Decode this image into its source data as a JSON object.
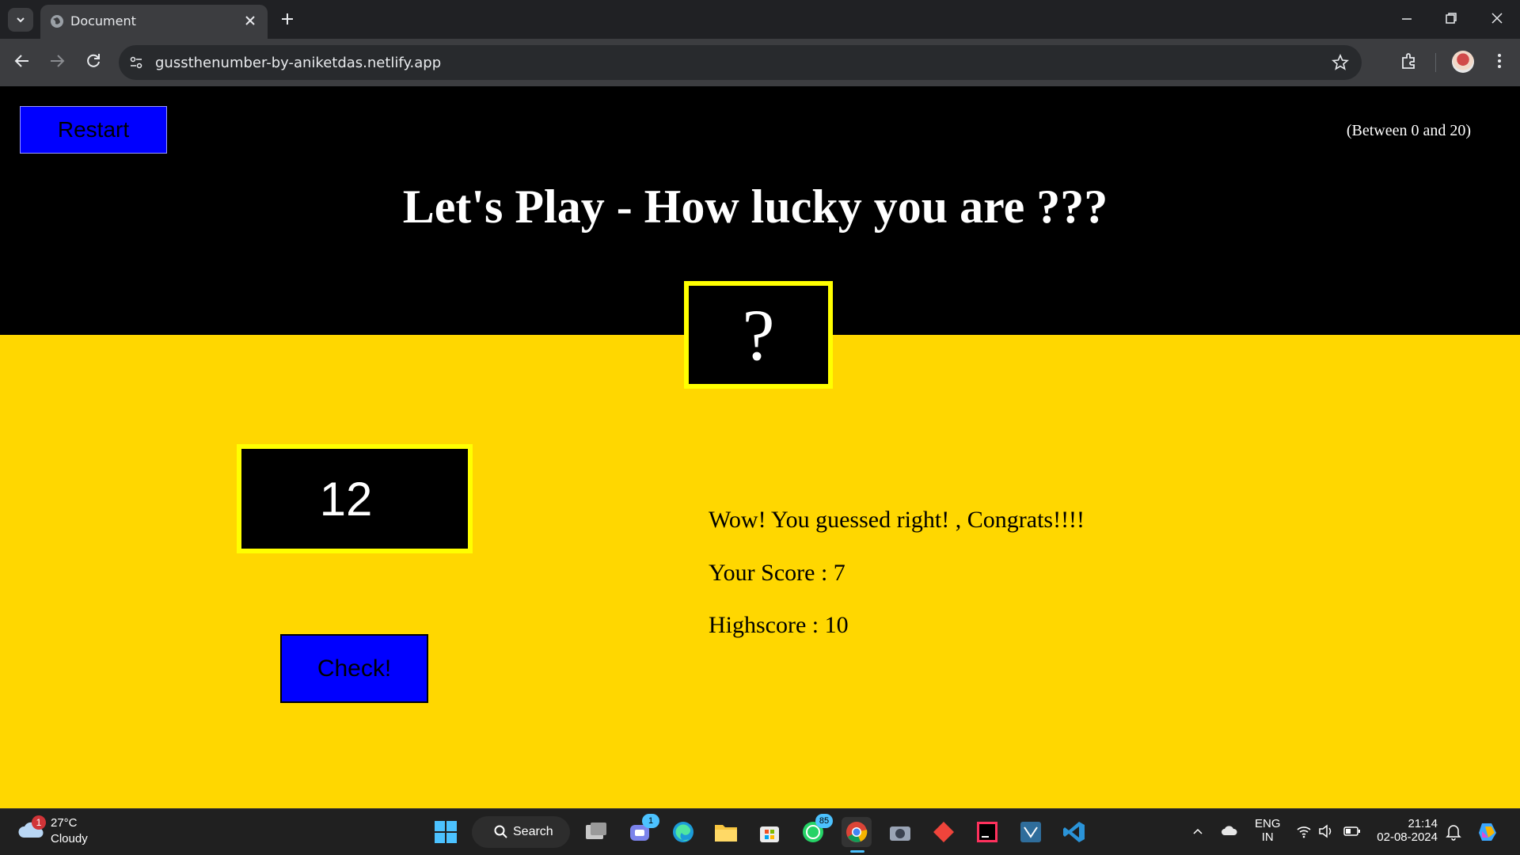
{
  "browser": {
    "tab_title": "Document",
    "url": "gussthenumber-by-aniketdas.netlify.app"
  },
  "game": {
    "restart_label": "Restart",
    "range_hint": "(Between 0 and 20)",
    "title": "Let's Play - How lucky you are ???",
    "secret_number": "?",
    "guess_value": "12",
    "check_label": "Check!",
    "message": "Wow! You guessed right! , Congrats!!!!",
    "score_text": "Your Score : 7",
    "highscore_text": "Highscore : 10",
    "colors": {
      "top_bg": "#000000",
      "bottom_bg": "#ffd700",
      "button": "#0000ff",
      "box_border": "#ffff00"
    }
  },
  "taskbar": {
    "weather_badge": "1",
    "weather_temp": "27°C",
    "weather_desc": "Cloudy",
    "search_label": "Search",
    "teams_badge": "1",
    "whatsapp_badge": "85",
    "lang_top": "ENG",
    "lang_bottom": "IN",
    "time": "21:14",
    "date": "02-08-2024"
  }
}
